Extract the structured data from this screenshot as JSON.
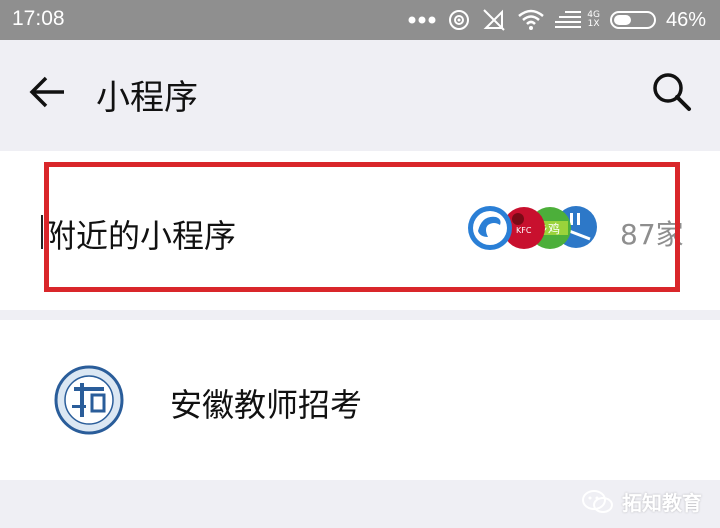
{
  "status_bar": {
    "time": "17:08",
    "network_type": "4G",
    "network_sub": "1X",
    "battery_percent": "46%",
    "battery_level": 0.46,
    "icons": [
      "more-dots-icon",
      "hotspot-icon",
      "no-signal-icon",
      "wifi-icon",
      "signal-icon",
      "battery-icon"
    ]
  },
  "header": {
    "title": "小程序",
    "back_icon": "back-arrow-icon",
    "search_icon": "search-icon"
  },
  "nearby": {
    "label": "附近的小程序",
    "count": "87家",
    "app_icons": [
      "ctrip-dolphin-icon",
      "kfc-icon",
      "xiangji-icon",
      "hotel-icon"
    ],
    "highlight_color": "#d9262a"
  },
  "mini_programs": [
    {
      "name": "安徽教师招考",
      "logo": "tuozhi-logo"
    }
  ],
  "watermark": {
    "text": "拓知教育",
    "icon": "wechat-icon"
  }
}
